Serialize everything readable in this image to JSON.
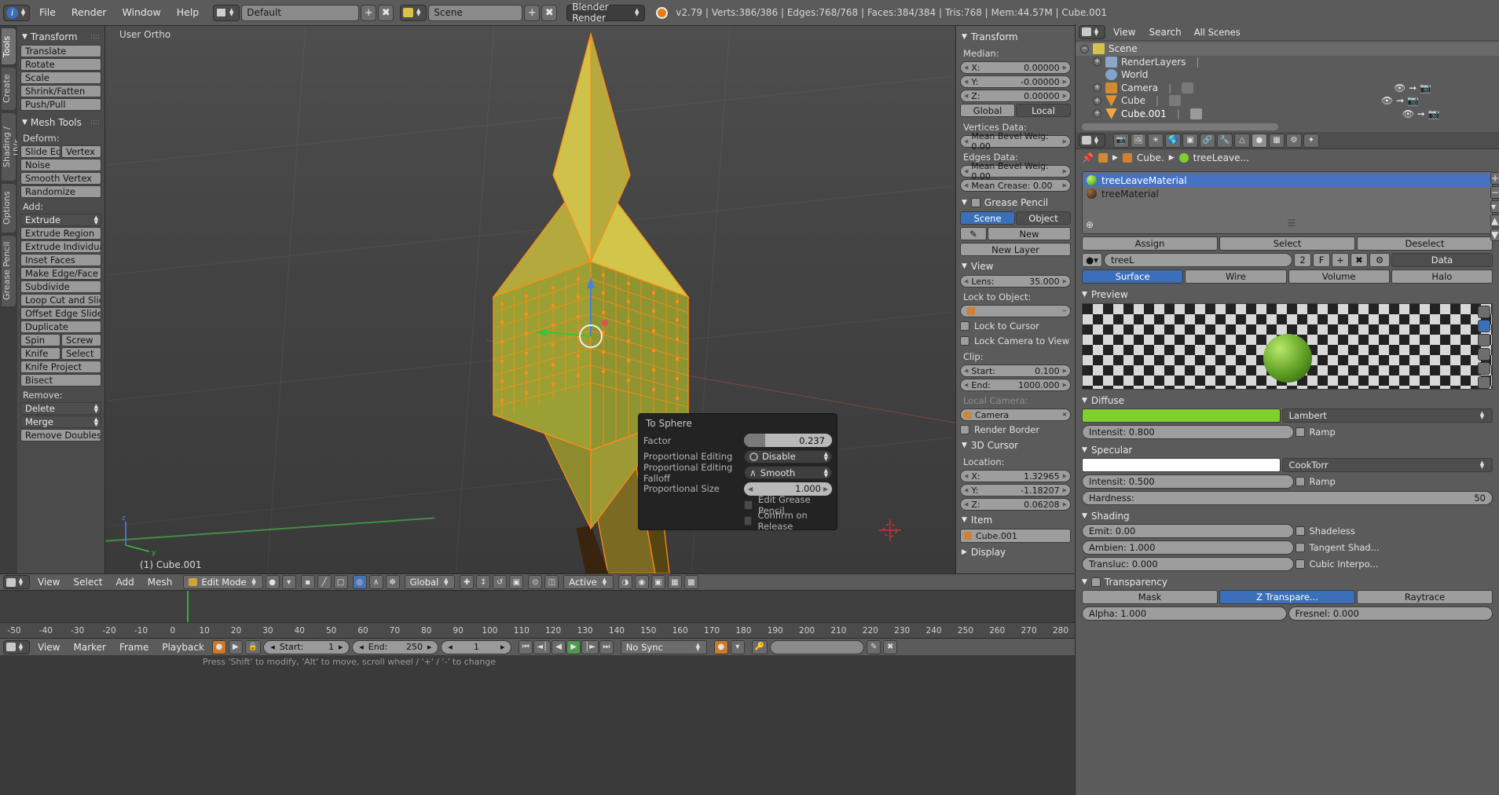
{
  "topbar": {
    "menus": [
      "File",
      "Render",
      "Window",
      "Help"
    ],
    "screen_layout": "Default",
    "scene_name": "Scene",
    "render_engine": "Blender Render",
    "version": "v2.79",
    "stats": "Verts:386/386 | Edges:768/768 | Faces:384/384 | Tris:768 | Mem:44.57M | Cube.001",
    "full_status": "v2.79 | Verts:386/386 | Edges:768/768 | Faces:384/384 | Tris:768 | Mem:44.57M | Cube.001"
  },
  "left_tabs": [
    "Tools",
    "Create",
    "Shading / UVs",
    "Options",
    "Grease Pencil"
  ],
  "tools": {
    "transform_header": "Transform",
    "transform_buttons": [
      "Translate",
      "Rotate",
      "Scale",
      "Shrink/Fatten",
      "Push/Pull"
    ],
    "mesh_tools_header": "Mesh Tools",
    "deform_label": "Deform:",
    "deform_pair": [
      "Slide Ed",
      "Vertex"
    ],
    "deform_buttons": [
      "Noise",
      "Smooth Vertex",
      "Randomize"
    ],
    "add_label": "Add:",
    "extrude_dropdown": "Extrude",
    "add_buttons": [
      "Extrude Region",
      "Extrude Individual",
      "Inset Faces",
      "Make Edge/Face",
      "Subdivide",
      "Loop Cut and Slide",
      "Offset Edge Slide",
      "Duplicate"
    ],
    "spin_screw": [
      "Spin",
      "Screw"
    ],
    "knife_select": [
      "Knife",
      "Select"
    ],
    "knife_project": "Knife Project",
    "bisect": "Bisect",
    "remove_label": "Remove:",
    "delete_dropdown": "Delete",
    "merge_dropdown": "Merge",
    "remove_doubles": "Remove Doubles"
  },
  "viewport": {
    "view_label": "User Ortho",
    "object_label": "(1) Cube.001"
  },
  "operator_panel": {
    "title": "To Sphere",
    "rows": [
      {
        "label": "Factor",
        "type": "slider",
        "value": "0.237",
        "fill_pct": 23.7
      },
      {
        "label": "Proportional Editing",
        "type": "enum",
        "value": "Disable",
        "icon": "circle-icon"
      },
      {
        "label": "Proportional Editing Falloff",
        "type": "enum",
        "value": "Smooth",
        "icon": "smooth-curve-icon"
      },
      {
        "label": "Proportional Size",
        "type": "number",
        "value": "1.000"
      }
    ],
    "checkboxes": [
      {
        "label": "Edit Grease Pencil",
        "checked": false
      },
      {
        "label": "Confirm on Release",
        "checked": false
      }
    ]
  },
  "viewport_header": {
    "menus": [
      "View",
      "Select",
      "Add",
      "Mesh"
    ],
    "mode": "Edit Mode",
    "transform_orientation": "Global",
    "pivot": "Active"
  },
  "timeline": {
    "ticks": [
      "-50",
      "-40",
      "-30",
      "-20",
      "-10",
      "0",
      "10",
      "20",
      "30",
      "40",
      "50",
      "60",
      "70",
      "80",
      "90",
      "100",
      "110",
      "120",
      "130",
      "140",
      "150",
      "160",
      "170",
      "180",
      "190",
      "200",
      "210",
      "220",
      "230",
      "240",
      "250",
      "260",
      "270",
      "280"
    ],
    "menus": [
      "View",
      "Marker",
      "Frame",
      "Playback"
    ],
    "start_label": "Start:",
    "start_value": "1",
    "end_label": "End:",
    "end_value": "250",
    "current_frame": "1",
    "sync_mode": "No Sync",
    "playhead_frame": 1
  },
  "status_bottom": "Press 'Shift' to modify, 'Alt' to move, scroll wheel / '+' / '-' to change",
  "n_panel": {
    "transform_header": "Transform",
    "median_label": "Median:",
    "median": [
      {
        "axis": "X:",
        "value": "0.00000"
      },
      {
        "axis": "Y:",
        "value": "-0.00000"
      },
      {
        "axis": "Z:",
        "value": "0.00000"
      }
    ],
    "space_buttons": [
      "Global",
      "Local"
    ],
    "space_selected": "Local",
    "vertices_data_label": "Vertices Data:",
    "vertex_bevel": "Mean Bevel Weig: 0.00",
    "edges_data_label": "Edges Data:",
    "edge_bevel": "Mean Bevel Weig: 0.00",
    "mean_crease": "Mean Crease:   0.00",
    "grease_pencil_header": "Grease Pencil",
    "gp_tabs": [
      "Scene",
      "Object"
    ],
    "gp_tab_selected": "Scene",
    "gp_new": "New",
    "gp_new_layer": "New Layer",
    "view_header": "View",
    "lens_label": "Lens:",
    "lens_value": "35.000",
    "lock_to_object_label": "Lock to Object:",
    "lock_to_cursor": "Lock to Cursor",
    "lock_camera_to_view": "Lock Camera to View",
    "clip_label": "Clip:",
    "clip_start_label": "Start:",
    "clip_start": "0.100",
    "clip_end_label": "End:",
    "clip_end": "1000.000",
    "local_camera_label": "Local Camera:",
    "local_camera": "Camera",
    "render_border": "Render Border",
    "cursor_header": "3D Cursor",
    "location_label": "Location:",
    "cursor": [
      {
        "axis": "X:",
        "value": "1.32965"
      },
      {
        "axis": "Y:",
        "value": "-1.18207"
      },
      {
        "axis": "Z:",
        "value": "0.06208"
      }
    ],
    "item_header": "Item",
    "item_name": "Cube.001",
    "display_header": "Display"
  },
  "outliner": {
    "header_menus": [
      "View",
      "Search"
    ],
    "filter": "All Scenes",
    "rows": [
      {
        "label": "Scene",
        "indent": 0,
        "icon": "scene-icon",
        "expander": "minus",
        "selected": true
      },
      {
        "label": "RenderLayers",
        "indent": 1,
        "icon": "renderlayers-icon",
        "expander": "plus",
        "selected": false
      },
      {
        "label": "World",
        "indent": 1,
        "icon": "world-icon",
        "expander": "none",
        "selected": false
      },
      {
        "label": "Camera",
        "indent": 1,
        "icon": "camera-icon",
        "expander": "plus",
        "selected": false
      },
      {
        "label": "Cube",
        "indent": 1,
        "icon": "mesh-icon",
        "expander": "plus",
        "selected": false
      },
      {
        "label": "Cube.001",
        "indent": 1,
        "icon": "mesh-icon-active",
        "expander": "plus",
        "selected": false
      }
    ]
  },
  "properties": {
    "breadcrumb": [
      "Cube.",
      "treeLeave..."
    ],
    "materials": [
      {
        "name": "treeLeaveMaterial",
        "color": "#6fc22a",
        "selected": true
      },
      {
        "name": "treeMaterial",
        "color": "#5a3a22",
        "selected": false
      }
    ],
    "assign_row": [
      "Assign",
      "Select",
      "Deselect"
    ],
    "datablock": {
      "name": "treeL",
      "users": "2",
      "fake": "F",
      "data_label": "Data"
    },
    "surface_tabs": [
      "Surface",
      "Wire",
      "Volume",
      "Halo"
    ],
    "surface_selected": "Surface",
    "preview_header": "Preview",
    "diffuse_header": "Diffuse",
    "diffuse_color": "#7fd02e",
    "diffuse_shader": "Lambert",
    "diffuse_intensity": "Intensit: 0.800",
    "diffuse_ramp": "Ramp",
    "specular_header": "Specular",
    "specular_color": "#ffffff",
    "specular_shader": "CookTorr",
    "specular_intensity": "Intensit: 0.500",
    "specular_ramp": "Ramp",
    "hardness_label": "Hardness:",
    "hardness_value": "50",
    "shading_header": "Shading",
    "emit": "Emit:   0.00",
    "ambient": "Ambien: 1.000",
    "translucency": "Transluc: 0.000",
    "shadeless": "Shadeless",
    "tangent_shading": "Tangent Shad...",
    "cubic_interpolation": "Cubic Interpo...",
    "transparency_header": "Transparency",
    "transparency_tabs": [
      "Mask",
      "Z Transpare...",
      "Raytrace"
    ],
    "transparency_selected": "Z Transpare...",
    "alpha_label": "Alpha:  1.000",
    "fresnel_label": "Fresnel: 0.000"
  }
}
